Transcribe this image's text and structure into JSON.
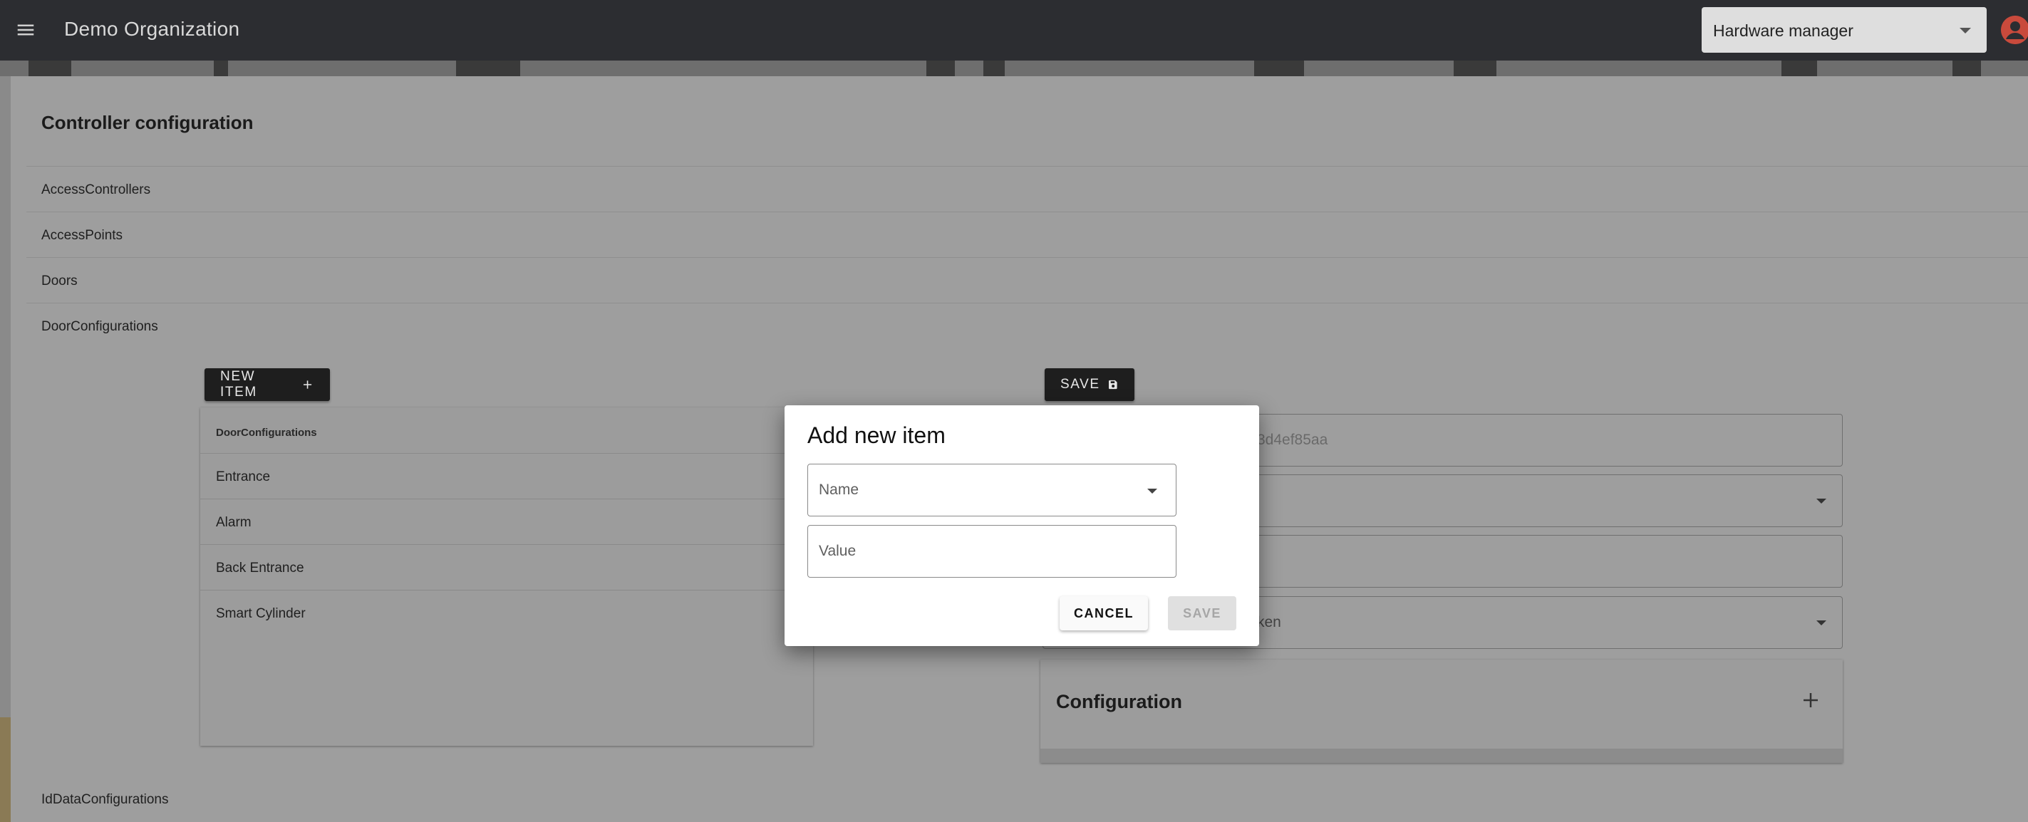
{
  "appbar": {
    "org_name": "Demo Organization",
    "role": "Hardware manager"
  },
  "page": {
    "title": "Controller configuration",
    "sections": [
      {
        "label": "AccessControllers"
      },
      {
        "label": "AccessPoints"
      },
      {
        "label": "Doors"
      },
      {
        "label": "DoorConfigurations"
      }
    ],
    "bottom_section": "IdDataConfigurations"
  },
  "list": {
    "new_item_label": "NEW ITEM",
    "header": "DoorConfigurations",
    "items": [
      "Entrance",
      "Alarm",
      "Back Entrance",
      "Smart Cylinder"
    ]
  },
  "form": {
    "save_label": "SAVE",
    "id_value_partial": "3d4ef85aa",
    "field4_partial": "ken",
    "configuration_title": "Configuration"
  },
  "dialog": {
    "title": "Add new item",
    "name_label": "Name",
    "value_label": "Value",
    "cancel_label": "CANCEL",
    "save_label": "SAVE"
  }
}
